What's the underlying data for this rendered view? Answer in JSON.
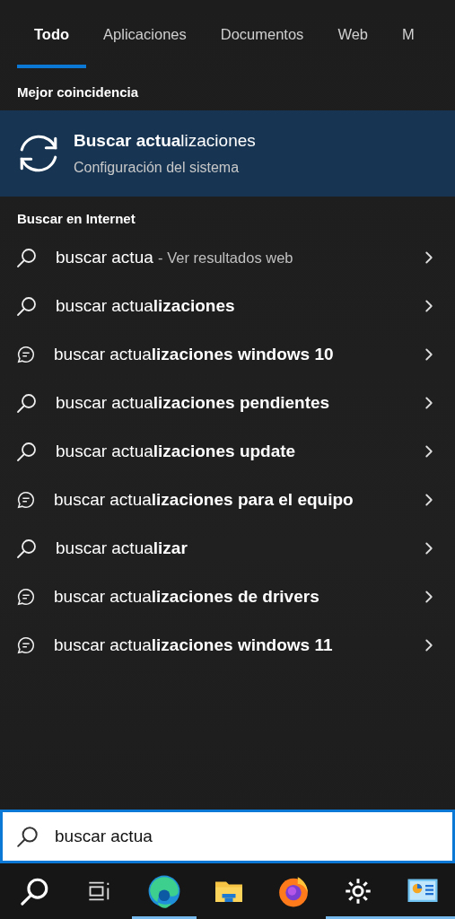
{
  "tabs": [
    {
      "label": "Todo",
      "selected": true
    },
    {
      "label": "Aplicaciones",
      "selected": false
    },
    {
      "label": "Documentos",
      "selected": false
    },
    {
      "label": "Web",
      "selected": false
    },
    {
      "label": "M",
      "selected": false
    }
  ],
  "best_match": {
    "heading": "Mejor coincidencia",
    "title": "**Buscar actua**lizaciones",
    "subtitle": "Configuración del sistema",
    "selected": true
  },
  "web_section": {
    "heading": "Buscar en Internet",
    "results": [
      {
        "kind": "search",
        "text": "buscar actua",
        "hint": "- Ver resultados web"
      },
      {
        "kind": "search",
        "text": "buscar actua**lizaciones**"
      },
      {
        "kind": "trend",
        "text": "buscar actua**lizaciones windows 10**"
      },
      {
        "kind": "search",
        "text": "buscar actua**lizaciones pendientes**"
      },
      {
        "kind": "search",
        "text": "buscar actua**lizaciones update**"
      },
      {
        "kind": "trend",
        "text": "buscar actua**lizaciones para el equipo**"
      },
      {
        "kind": "search",
        "text": "buscar actua**lizar**"
      },
      {
        "kind": "trend",
        "text": "buscar actua**lizaciones de drivers**"
      },
      {
        "kind": "trend",
        "text": "buscar actua**lizaciones windows 11**"
      }
    ]
  },
  "search_box": {
    "value": "buscar actua"
  },
  "taskbar": [
    {
      "kind": "search",
      "open": false
    },
    {
      "kind": "taskview",
      "open": false
    },
    {
      "kind": "browser",
      "open": true
    },
    {
      "kind": "folder",
      "open": false
    },
    {
      "kind": "firefox",
      "open": false
    },
    {
      "kind": "settings",
      "open": true
    },
    {
      "kind": "panel",
      "open": true
    }
  ]
}
